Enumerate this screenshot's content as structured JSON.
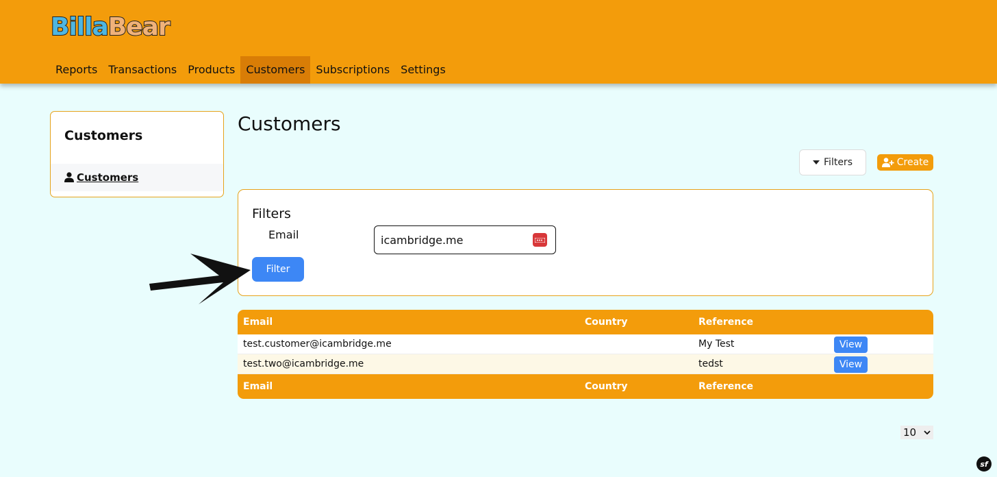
{
  "header": {
    "logo_part1": "Billa",
    "logo_part2": "Bear",
    "nav": [
      {
        "label": "Reports"
      },
      {
        "label": "Transactions"
      },
      {
        "label": "Products"
      },
      {
        "label": "Customers",
        "active": true
      },
      {
        "label": "Subscriptions"
      },
      {
        "label": "Settings"
      }
    ]
  },
  "sidebar": {
    "title": "Customers",
    "items": [
      {
        "label": "Customers",
        "icon": "user-icon"
      }
    ]
  },
  "main": {
    "title": "Customers",
    "filters_button": "Filters",
    "create_button": "Create",
    "filter_panel": {
      "title": "Filters",
      "email_label": "Email",
      "email_value": "icambridge.me",
      "submit_label": "Filter"
    },
    "table": {
      "columns": [
        "Email",
        "Country",
        "Reference"
      ],
      "rows": [
        {
          "email": "test.customer@icambridge.me",
          "country": "",
          "reference": "My Test",
          "action": "View"
        },
        {
          "email": "test.two@icambridge.me",
          "country": "",
          "reference": "tedst",
          "action": "View"
        }
      ]
    },
    "per_page": "10"
  },
  "colors": {
    "brand": "#f39c0b",
    "nav_active": "#d97d06",
    "primary": "#3d87f5",
    "background": "#e9fdfd"
  }
}
